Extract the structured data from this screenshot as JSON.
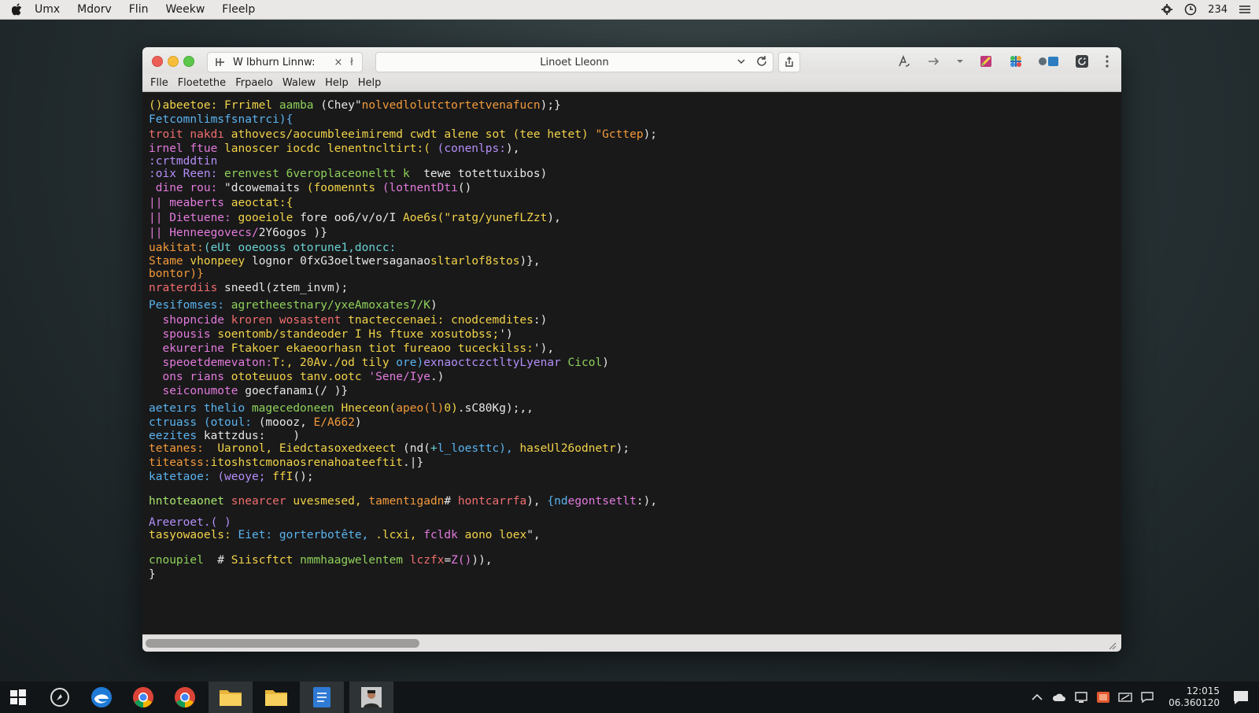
{
  "menubar": {
    "items": [
      "Umx",
      "Mdorv",
      "Flin",
      "Weekw",
      "Fleelp"
    ],
    "right_text": "234"
  },
  "window": {
    "tab_title": "W lbhurn Linnw:",
    "tab_close": "×",
    "tab_extra": "ł",
    "address": "Linoet Lleonn",
    "menu": [
      "Flle",
      "Floetethe",
      "Frpaelo",
      "Walew",
      "Help",
      "Help"
    ]
  },
  "code": {
    "l01": [
      "()abeetoe: Frrimel ",
      "aamba ",
      "(Chey\"",
      "nolvedlolutctortetvenafucn",
      ");}"
    ],
    "l02": [
      "Fetcomnlimsfsnatrci){"
    ],
    "l03": [
      "troit nakdı ",
      "athovecs/aocumbleeimiremd cwdt alene sot (tee hetet) ",
      "\"Gcttep",
      ");"
    ],
    "l04": [
      "irnel ftue ",
      "lanoscer iocdc lenentncltirt:( ",
      "(conenlps:",
      "),"
    ],
    "l05": [
      ":crtmddtin"
    ],
    "l06": [
      ":oix Reen: ",
      "erenvest 6veroplaceoneltt k  ",
      "tewe totettuxibos)"
    ],
    "l07": [
      " dine rou: ",
      "\"dcowemaits ",
      "(foomennts ",
      "(lotnentDtı",
      "()"
    ],
    "l08": [
      "|| meaberts ",
      "aeoctat:{"
    ],
    "l09": [
      "|| Dietuene: ",
      "gooeiole ",
      "fore oo6/v/o/I ",
      "Aoe6s(\"ratg/yunefLZzt",
      "),"
    ],
    "l10": [
      "|| Henneegovecs/",
      "2Y6ogos )}"
    ],
    "l11": [
      "uakitat:",
      "(eUt ooeooss otorune1,doncc:"
    ],
    "l12": [
      "Stame ",
      "vhonpeey ",
      "lognor 0fxG3oeltwersaganao",
      "sltarlof8stos",
      ")},"
    ],
    "l13": [
      "bontor)}"
    ],
    "l14": [
      "nraterdiis ",
      "sneedl(ztem_invm)",
      ";"
    ],
    "l15": [
      "Pesifomses: ",
      "agretheestnary/yxeAmoxates7/K",
      ")"
    ],
    "l16": [
      "  shopncide ",
      "kroren wosastent ",
      "tnacteccenaei: cnodcemdites",
      ":)"
    ],
    "l17": [
      "  spousis ",
      "soentomb/standeoder I ",
      "Hs ftuxe xosutobss;",
      "')"
    ],
    "l18": [
      "  ekurerine ",
      "Ftakoer ",
      "ekaeoorhasn tiot fureaoo tuceckilss:",
      "'),"
    ],
    "l19": [
      "  speoetdemevaton:",
      "T:, 20Av./od tily ",
      "ore)",
      "exnaoctczctltyLyenar ",
      "Cicol",
      ")"
    ],
    "l20": [
      "  ons ",
      "rians ",
      "ototeuuos tanv.ootc ",
      "'Sene/Iye",
      ".)"
    ],
    "l21": [
      "  seiconumote ",
      "goecfanamı(/ )}"
    ],
    "l22": [
      "aeteırs ",
      "thelio ",
      "magecedoneen ",
      "Hneceon(",
      "apeo(l)",
      "0)",
      ".sC80Kg);,,"
    ],
    "l23": [
      "ctruass ",
      "(otoul: ",
      "(moooz, ",
      "E/A662",
      ")"
    ],
    "l24": [
      "eezites ",
      "kattzdus:    )"
    ],
    "l25": [
      "tetanes:  ",
      "Uaronol, ",
      "Eied",
      "ctasoxedxeect ",
      "(nd(",
      "+",
      "l_loesttc), ",
      "haseUl26odnetr",
      ");"
    ],
    "l26": [
      "titeatss:",
      "itoshstcmonaosrenahoateeftit",
      ".|}"
    ],
    "l27": [
      "katetaoe: ",
      "(weoye; ",
      "ffI",
      "();"
    ],
    "l28": [
      "hntoteaonet ",
      "snearcer ",
      "uvesmesed, ",
      "tamentıgadn",
      "# ",
      "hontcarrfa",
      "), ",
      "{nd",
      "egontsetlt",
      ":),"
    ],
    "l29": [
      "Areeroet.( )"
    ],
    "l30": [
      "tasyowaoels: ",
      "Eiet: ",
      "gorterbotête, ",
      ".lcxi, ",
      "fcldk ",
      "aono ",
      "loex",
      "\","
    ],
    "l31": [
      "cnoupiel ",
      " # ",
      "Sıiscftct ",
      "nmmhaagwelentem ",
      "lczfx",
      "=",
      "Z()",
      ")),"
    ],
    "l32": [
      "}"
    ]
  },
  "taskbar": {
    "clock_time": "12:015",
    "clock_date": "06.360120"
  }
}
